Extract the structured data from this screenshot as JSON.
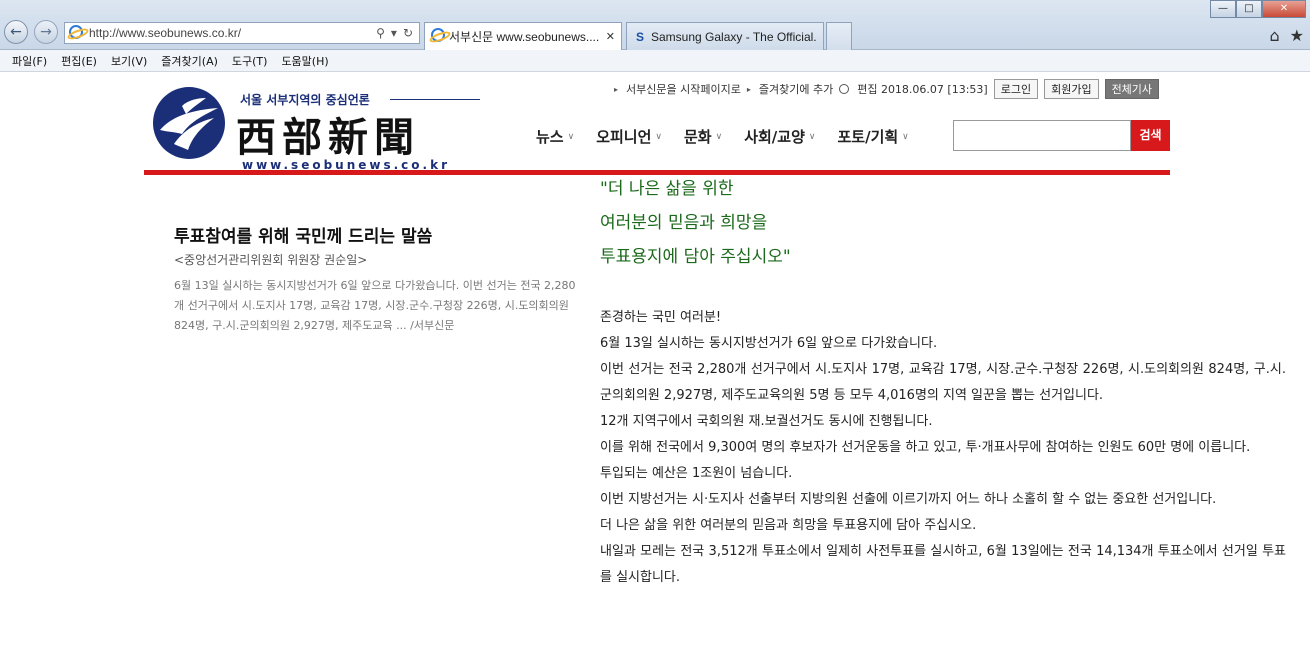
{
  "browser": {
    "url": "http://www.seobunews.co.kr/",
    "tabs": [
      {
        "title": "서부신문 www.seobunews....",
        "active": true
      },
      {
        "title": "Samsung Galaxy - The Official...",
        "active": false
      }
    ],
    "menu": [
      "파일(F)",
      "편집(E)",
      "보기(V)",
      "즐겨찾기(A)",
      "도구(T)",
      "도움말(H)"
    ]
  },
  "site": {
    "slogan": "서울 서부지역의 중심언론",
    "name": "西部新聞",
    "domain": "www.seobunews.co.kr",
    "util": {
      "start_page": "서부신문을 시작페이지로",
      "favorite": "즐겨찾기에 추가",
      "edit_time": "편집 2018.06.07 [13:53]",
      "login": "로그인",
      "signup": "회원가입",
      "all_articles": "전체기사"
    },
    "nav": [
      "뉴스",
      "오피니언",
      "문화",
      "사회/교양",
      "포토/기획"
    ],
    "search_button": "검색",
    "search_value": ""
  },
  "article_card": {
    "headline": "투표참여를 위해 국민께 드리는 말씀",
    "subhead": "<중앙선거관리위원회 위원장 권순일>",
    "summary": "6월 13일 실시하는 동시지방선거가 6일 앞으로 다가왔습니다. 이번 선거는 전국 2,280개 선거구에서 시.도지사 17명, 교육감 17명, 시장.군수.구청장 226명, 시.도의회의원 824명, 구.시.군의회의원 2,927명, 제주도교육 ... /서부신문"
  },
  "article_body": {
    "quote": [
      "\"더 나은 삶을 위한",
      "여러분의 믿음과 희망을",
      "투표용지에 담아 주십시오\""
    ],
    "paragraphs": [
      "존경하는 국민 여러분!",
      "6월 13일 실시하는 동시지방선거가 6일 앞으로 다가왔습니다.",
      "이번 선거는 전국 2,280개 선거구에서 시.도지사 17명, 교육감 17명, 시장.군수.구청장 226명, 시.도의회의원 824명, 구.시.군의회의원 2,927명, 제주도교육의원 5명 등 모두 4,016명의 지역 일꾼을 뽑는 선거입니다.",
      "12개 지역구에서 국회의원 재.보궐선거도 동시에 진행됩니다.",
      "이를 위해 전국에서 9,300여 명의 후보자가 선거운동을 하고 있고, 투·개표사무에 참여하는 인원도 60만 명에 이릅니다.",
      "투입되는 예산은 1조원이 넘습니다.",
      "이번 지방선거는 시·도지사 선출부터 지방의원 선출에 이르기까지 어느 하나 소홀히 할 수 없는 중요한 선거입니다.",
      "더 나은 삶을 위한 여러분의 믿음과 희망을 투표용지에 담아 주십시오.",
      "내일과 모레는 전국 3,512개 투표소에서 일제히 사전투표를 실시하고, 6월 13일에는 전국 14,134개 투표소에서 선거일 투표를 실시합니다."
    ]
  },
  "colors": {
    "accent_red": "#d7191c",
    "quote_green": "#1b6a1b",
    "brand_navy": "#1b2f78"
  }
}
